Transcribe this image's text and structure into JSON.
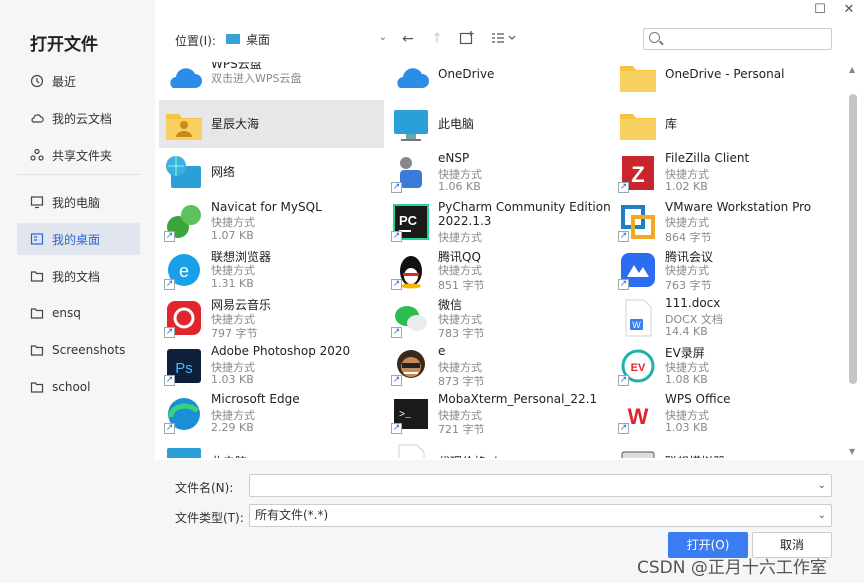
{
  "dialog": {
    "title": "打开文件"
  },
  "sidebar": {
    "items": [
      {
        "label": "最近",
        "icon": "clock-icon"
      },
      {
        "label": "我的云文档",
        "icon": "cloud-icon"
      },
      {
        "label": "共享文件夹",
        "icon": "share-icon"
      },
      {
        "label": "我的电脑",
        "icon": "monitor-icon"
      },
      {
        "label": "我的桌面",
        "icon": "desktop-icon",
        "active": true
      },
      {
        "label": "我的文档",
        "icon": "folder-icon"
      },
      {
        "label": "ensq",
        "icon": "folder-icon"
      },
      {
        "label": "Screenshots",
        "icon": "folder-icon"
      },
      {
        "label": "school",
        "icon": "folder-icon"
      }
    ]
  },
  "toolbar": {
    "location_label": "位置(I):",
    "location_value": "桌面",
    "search_placeholder": ""
  },
  "files": [
    {
      "name": "WPS云盘",
      "sub1": "双击进入WPS云盘",
      "sub2": "",
      "icon": "wps-cloud-icon",
      "color": "#2b8de8",
      "shortcut": false
    },
    {
      "name": "OneDrive",
      "sub1": "",
      "sub2": "",
      "icon": "onedrive-icon",
      "color": "#2b8de8",
      "shortcut": false
    },
    {
      "name": "OneDrive - Personal",
      "sub1": "",
      "sub2": "",
      "icon": "folder-icon",
      "color": "#f5c542",
      "shortcut": false
    },
    {
      "name": "星辰大海",
      "sub1": "",
      "sub2": "",
      "icon": "user-folder-icon",
      "color": "#f5c542",
      "shortcut": false,
      "selected": true
    },
    {
      "name": "此电脑",
      "sub1": "",
      "sub2": "",
      "icon": "computer-icon",
      "color": "#2a9fd8",
      "shortcut": false
    },
    {
      "name": "库",
      "sub1": "",
      "sub2": "",
      "icon": "folder-icon",
      "color": "#f5c542",
      "shortcut": false
    },
    {
      "name": "网络",
      "sub1": "",
      "sub2": "",
      "icon": "network-icon",
      "color": "#2a9fd8",
      "shortcut": false
    },
    {
      "name": "eNSP",
      "sub1": "快捷方式",
      "sub2": "1.06 KB",
      "icon": "ensp-icon",
      "color": "#3b7ad9",
      "shortcut": true
    },
    {
      "name": "FileZilla Client",
      "sub1": "快捷方式",
      "sub2": "1.02 KB",
      "icon": "filezilla-icon",
      "color": "#c9252c",
      "shortcut": true
    },
    {
      "name": "Navicat for MySQL",
      "sub1": "快捷方式",
      "sub2": "1.07 KB",
      "icon": "navicat-icon",
      "color": "#3aa63a",
      "shortcut": true
    },
    {
      "name": "PyCharm Community Edition",
      "name2": "2022.1.3",
      "sub1": "快捷方式",
      "sub2": "",
      "icon": "pycharm-icon",
      "color": "#1a1a1a",
      "shortcut": true
    },
    {
      "name": "VMware Workstation Pro",
      "sub1": "快捷方式",
      "sub2": "864 字节",
      "icon": "vmware-icon",
      "color": "#1f7fc4",
      "shortcut": true
    },
    {
      "name": "联想浏览器",
      "sub1": "快捷方式",
      "sub2": "1.31 KB",
      "icon": "lenovo-browser-icon",
      "color": "#1aa0e8",
      "shortcut": true
    },
    {
      "name": "腾讯QQ",
      "sub1": "快捷方式",
      "sub2": "851 字节",
      "icon": "qq-icon",
      "color": "#111111",
      "shortcut": true
    },
    {
      "name": "腾讯会议",
      "sub1": "快捷方式",
      "sub2": "763 字节",
      "icon": "tencent-meeting-icon",
      "color": "#2b6cf0",
      "shortcut": true
    },
    {
      "name": "网易云音乐",
      "sub1": "快捷方式",
      "sub2": "797 字节",
      "icon": "netease-music-icon",
      "color": "#e0262c",
      "shortcut": true
    },
    {
      "name": "微信",
      "sub1": "快捷方式",
      "sub2": "783 字节",
      "icon": "wechat-icon",
      "color": "#2bbd4e",
      "shortcut": true
    },
    {
      "name": "111.docx",
      "sub1": "DOCX 文档",
      "sub2": "14.4 KB",
      "icon": "docx-icon",
      "color": "#3b7cf0",
      "shortcut": false
    },
    {
      "name": "Adobe Photoshop 2020",
      "sub1": "快捷方式",
      "sub2": "1.03 KB",
      "icon": "photoshop-icon",
      "color": "#0d1f3a",
      "shortcut": true
    },
    {
      "name": "e",
      "sub1": "快捷方式",
      "sub2": "873 字节",
      "icon": "avatar-shortcut-icon",
      "color": "#6b4a2a",
      "shortcut": true
    },
    {
      "name": "EV录屏",
      "sub1": "快捷方式",
      "sub2": "1.08 KB",
      "icon": "ev-recorder-icon",
      "color": "#1fb0a8",
      "shortcut": true
    },
    {
      "name": "Microsoft Edge",
      "sub1": "快捷方式",
      "sub2": "2.29 KB",
      "icon": "edge-icon",
      "color": "#1a8fd8",
      "shortcut": true
    },
    {
      "name": "MobaXterm_Personal_22.1",
      "sub1": "快捷方式",
      "sub2": "721 字节",
      "icon": "mobaxterm-icon",
      "color": "#1a1a1a",
      "shortcut": true
    },
    {
      "name": "WPS Office",
      "sub1": "快捷方式",
      "sub2": "1.03 KB",
      "icon": "wps-office-icon",
      "color": "#e0262c",
      "shortcut": true
    },
    {
      "name": "此电脑",
      "sub1": "",
      "sub2": "",
      "icon": "computer-icon",
      "color": "#2a9fd8",
      "shortcut": true
    },
    {
      "name": "代理价格.docx",
      "sub1": "",
      "sub2": "",
      "icon": "docx-icon",
      "color": "#3b7cf0",
      "shortcut": true
    },
    {
      "name": "联想模拟器",
      "sub1": "",
      "sub2": "",
      "icon": "emulator-icon",
      "color": "#2a2a2a",
      "shortcut": true
    }
  ],
  "form": {
    "filename_label": "文件名(N):",
    "filename_value": "",
    "filetype_label": "文件类型(T):",
    "filetype_value": "所有文件(*.*)",
    "open_button": "打开(O)",
    "cancel_button": "取消"
  },
  "watermark": "CSDN @正月十六工作室"
}
